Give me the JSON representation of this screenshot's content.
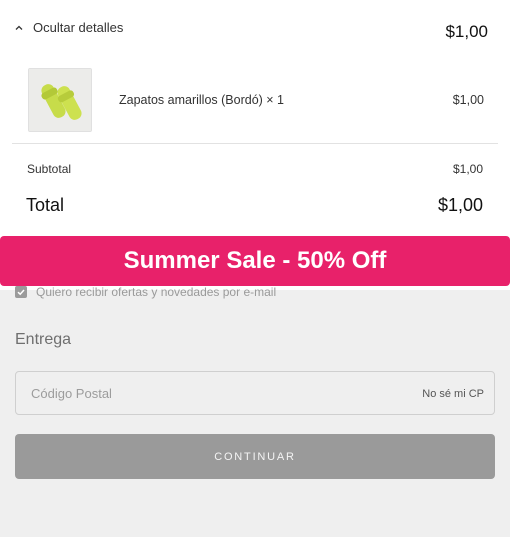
{
  "summary": {
    "toggle_label": "Ocultar detalles",
    "header_total": "$1,00",
    "product": {
      "name": "Zapatos amarillos (Bordó) × 1",
      "price": "$1,00"
    },
    "subtotal_label": "Subtotal",
    "subtotal_value": "$1,00",
    "total_label": "Total",
    "total_value": "$1,00"
  },
  "banner": {
    "text": "Summer Sale - 50% Off",
    "color": "#e8216a"
  },
  "newsletter": {
    "label": "Quiero recibir ofertas y novedades por e-mail",
    "checked": true
  },
  "delivery": {
    "title": "Entrega",
    "zip_placeholder": "Código Postal",
    "zip_help": "No sé mi CP"
  },
  "continue_label": "CONTINUAR",
  "icons": {
    "toggle": "chevron-up-icon",
    "checkbox": "check-icon",
    "product": "yellow-sandals-image"
  }
}
